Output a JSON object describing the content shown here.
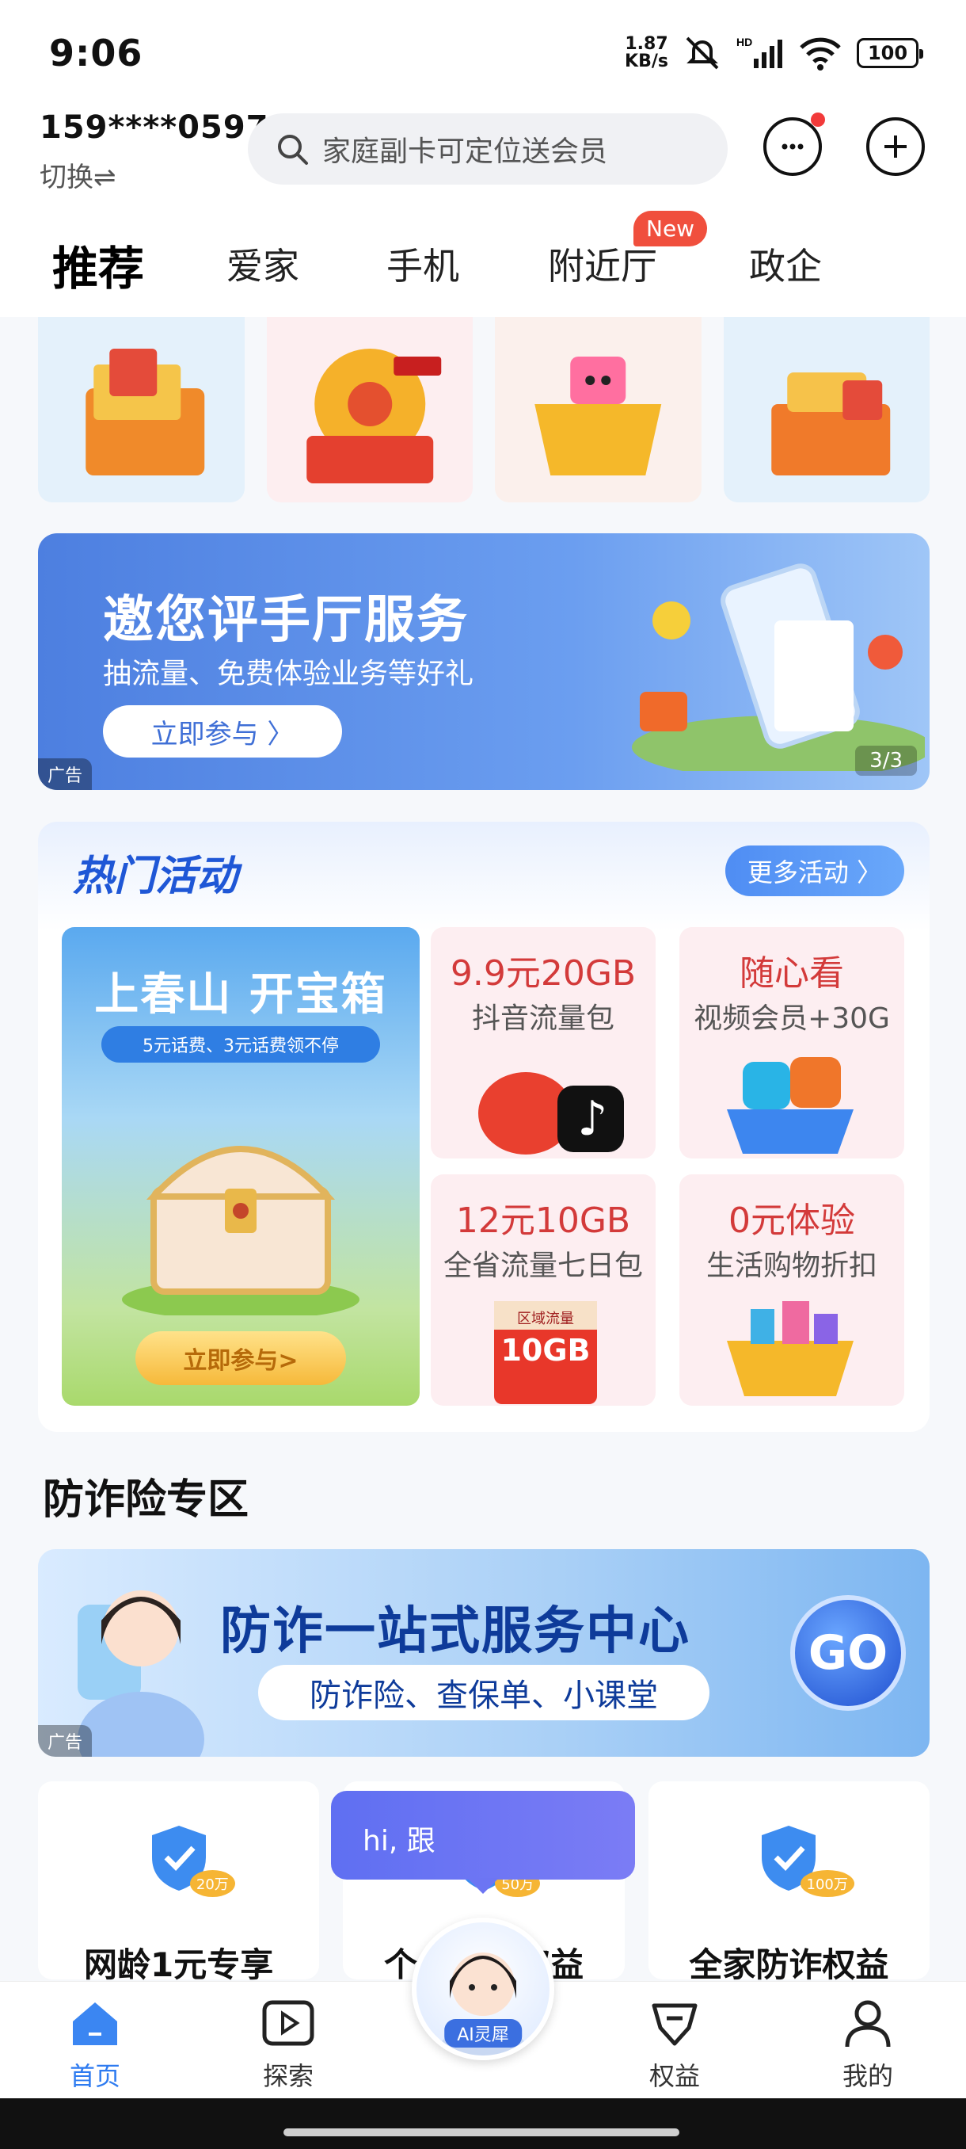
{
  "status_bar": {
    "time": "9:06",
    "net_speed_value": "1.87",
    "net_speed_unit": "KB/s",
    "battery": "100"
  },
  "header": {
    "phone": "159****0597",
    "switch_label": "切换⇌",
    "search_placeholder": "家庭副卡可定位送会员"
  },
  "tabs": [
    {
      "label": "推荐",
      "active": true
    },
    {
      "label": "爱家",
      "active": false
    },
    {
      "label": "手机",
      "active": false
    },
    {
      "label": "附近厅",
      "active": false,
      "badge": "New"
    },
    {
      "label": "政企",
      "active": false
    }
  ],
  "top_cards_colors": [
    "#e4f1fb",
    "#fdeef0",
    "#fbf0ec",
    "#e4f1fb"
  ],
  "banner": {
    "title": "邀您评手厅服务",
    "subtitle": "抽流量、免费体验业务等好礼",
    "button": "立即参与 〉",
    "index": "3/3",
    "ad": "广告"
  },
  "hot": {
    "title": "热门活动",
    "more": "更多活动 〉",
    "big": {
      "title": "上春山 开宝箱",
      "subtitle": "5元话费、3元话费领不停",
      "button": "立即参与>"
    },
    "cells": [
      {
        "title": "9.9元20GB",
        "subtitle": "抖音流量包"
      },
      {
        "title": "随心看",
        "subtitle": "视频会员+30G"
      },
      {
        "title": "12元10GB",
        "subtitle": "全省流量七日包",
        "tag": "区域流量",
        "tag_value": "10GB"
      },
      {
        "title": "0元体验",
        "subtitle": "生活购物折扣"
      }
    ]
  },
  "section_title": "防诈险专区",
  "fraud": {
    "title": "防诈一站式服务中心",
    "subtitle": "防诈险、查保单、小课堂",
    "go": "GO",
    "ad": "广告"
  },
  "bottom_cards": [
    {
      "label": "网龄1元专享",
      "amount": "20万"
    },
    {
      "label": "个人防诈权益",
      "amount": "50万"
    },
    {
      "label": "全家防诈权益",
      "amount": "100万"
    }
  ],
  "chat_bubble": "hi, 跟",
  "nav": {
    "home": "首页",
    "explore": "探索",
    "ai": "AI灵犀",
    "benefits": "权益",
    "mine": "我的"
  }
}
